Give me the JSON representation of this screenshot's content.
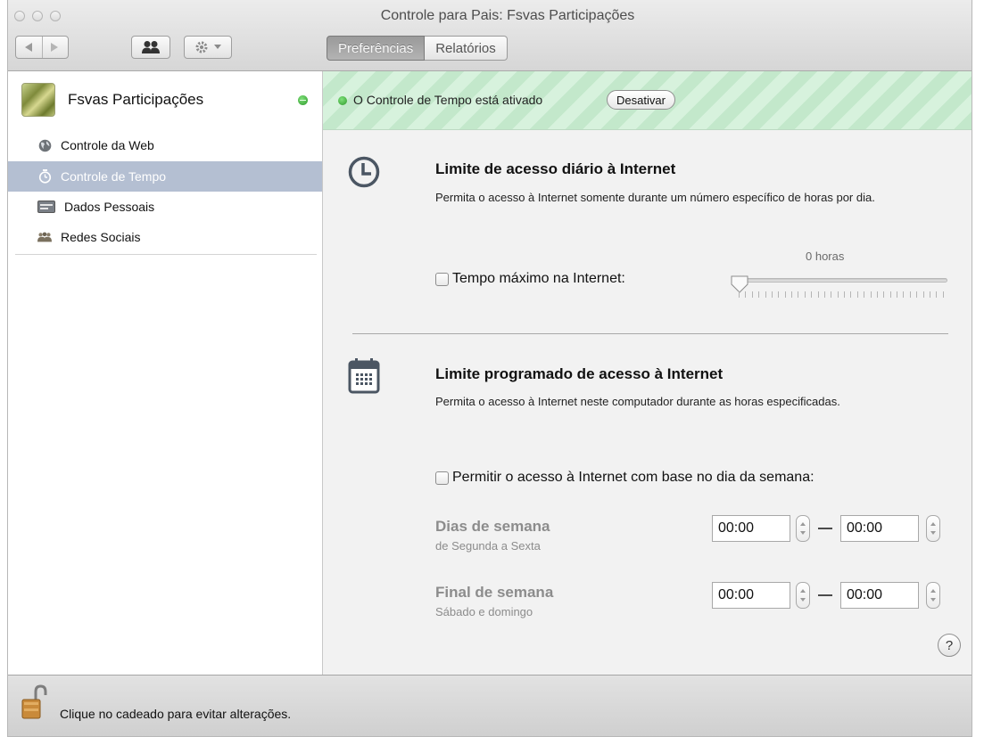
{
  "window": {
    "title": "Controle para Pais: Fsvas Participações"
  },
  "toolbar": {
    "tabs": [
      {
        "label": "Preferências",
        "active": true
      },
      {
        "label": "Relatórios",
        "active": false
      }
    ],
    "icons": [
      "back-icon",
      "forward-icon",
      "users-icon",
      "gear-icon"
    ]
  },
  "sidebar": {
    "account_name": "Fsvas Participações",
    "items": [
      {
        "label": "Controle da Web",
        "icon": "globe-icon",
        "selected": false
      },
      {
        "label": "Controle de Tempo",
        "icon": "stopwatch-icon",
        "selected": true
      },
      {
        "label": "Dados Pessoais",
        "icon": "card-icon",
        "selected": false
      },
      {
        "label": "Redes Sociais",
        "icon": "people-icon",
        "selected": false
      }
    ]
  },
  "banner": {
    "status_text": "O Controle de Tempo está ativado",
    "button_label": "Desativar",
    "status_color": "#3aa83a"
  },
  "daily_limit": {
    "title": "Limite de acesso diário à Internet",
    "description": "Permita o acesso à Internet somente durante um número específico de horas por dia.",
    "checkbox_label": "Tempo máximo na Internet:",
    "checked": false,
    "slider_value_label": "0 horas",
    "slider_value": 0
  },
  "scheduled_limit": {
    "title": "Limite programado de acesso à Internet",
    "description": "Permita o acesso à Internet neste computador durante as horas especificadas.",
    "checkbox_label": "Permitir o acesso à Internet com base no dia da semana:",
    "checked": false,
    "weekdays": {
      "title": "Dias de semana",
      "subtitle": "de Segunda a Sexta",
      "start": "00:00",
      "end": "00:00"
    },
    "weekend": {
      "title": "Final de semana",
      "subtitle": "Sábado e domingo",
      "start": "00:00",
      "end": "00:00"
    }
  },
  "help": {
    "label": "?"
  },
  "footer": {
    "lock_text": "Clique no cadeado para evitar alterações."
  }
}
